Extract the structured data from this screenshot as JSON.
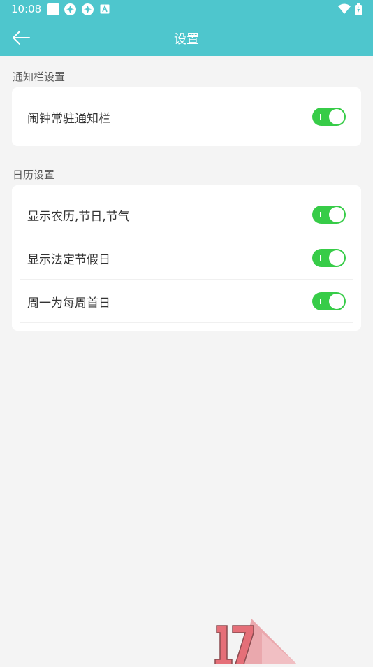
{
  "status_bar": {
    "time": "10:08",
    "icons": [
      "square-icon",
      "pinwheel-icon",
      "pinwheel-icon",
      "a-box-icon",
      "wifi-icon",
      "battery-icon"
    ]
  },
  "app_bar": {
    "title": "设置",
    "back_icon": "arrow-left-icon"
  },
  "sections": [
    {
      "title": "通知栏设置",
      "items": [
        {
          "label": "闹钟常驻通知栏",
          "enabled": true
        }
      ]
    },
    {
      "title": "日历设置",
      "items": [
        {
          "label": "显示农历,节日,节气",
          "enabled": true
        },
        {
          "label": "显示法定节假日",
          "enabled": true
        },
        {
          "label": "周一为每周首日",
          "enabled": true
        }
      ]
    }
  ],
  "colors": {
    "header": "#4ec6cd",
    "toggle_on": "#37cc48",
    "background": "#f4f4f4"
  }
}
